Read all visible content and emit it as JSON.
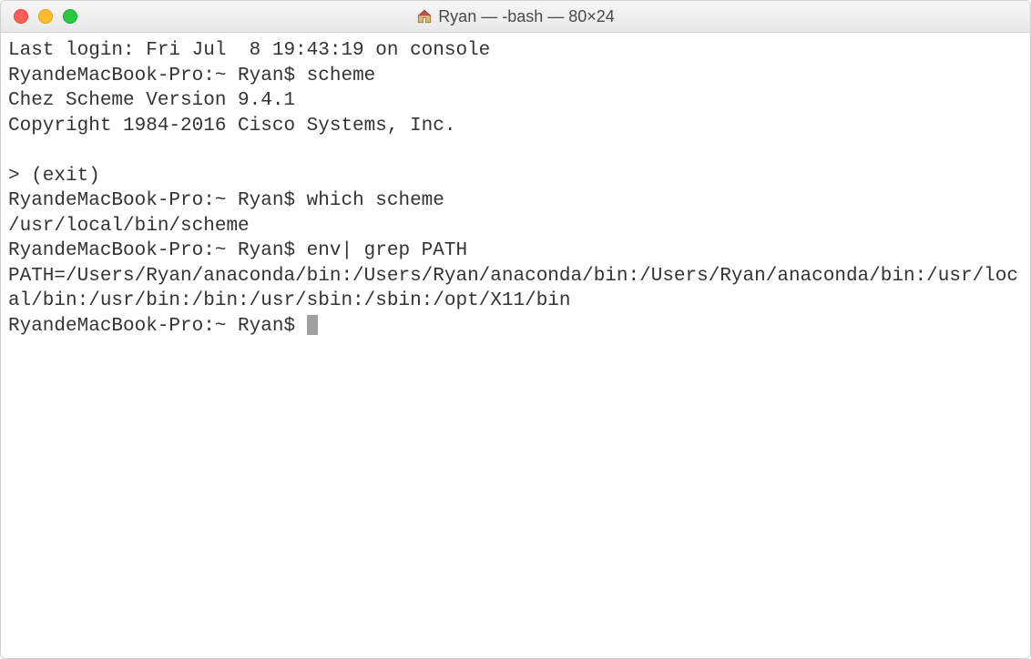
{
  "titlebar": {
    "title": "Ryan — -bash — 80×24"
  },
  "terminal": {
    "lines": [
      {
        "type": "text",
        "content": "Last login: Fri Jul  8 19:43:19 on console"
      },
      {
        "type": "prompt",
        "prompt": "RyandeMacBook-Pro:~ Ryan$ ",
        "command": "scheme"
      },
      {
        "type": "text",
        "content": "Chez Scheme Version 9.4.1"
      },
      {
        "type": "text",
        "content": "Copyright 1984-2016 Cisco Systems, Inc."
      },
      {
        "type": "text",
        "content": ""
      },
      {
        "type": "text",
        "content": "> (exit)"
      },
      {
        "type": "prompt",
        "prompt": "RyandeMacBook-Pro:~ Ryan$ ",
        "command": "which scheme"
      },
      {
        "type": "text",
        "content": "/usr/local/bin/scheme"
      },
      {
        "type": "prompt",
        "prompt": "RyandeMacBook-Pro:~ Ryan$ ",
        "command": "env| grep PATH"
      },
      {
        "type": "text",
        "content": "PATH=/Users/Ryan/anaconda/bin:/Users/Ryan/anaconda/bin:/Users/Ryan/anaconda/bin:/usr/local/bin:/usr/bin:/bin:/usr/sbin:/sbin:/opt/X11/bin"
      },
      {
        "type": "prompt_cursor",
        "prompt": "RyandeMacBook-Pro:~ Ryan$ "
      }
    ]
  }
}
